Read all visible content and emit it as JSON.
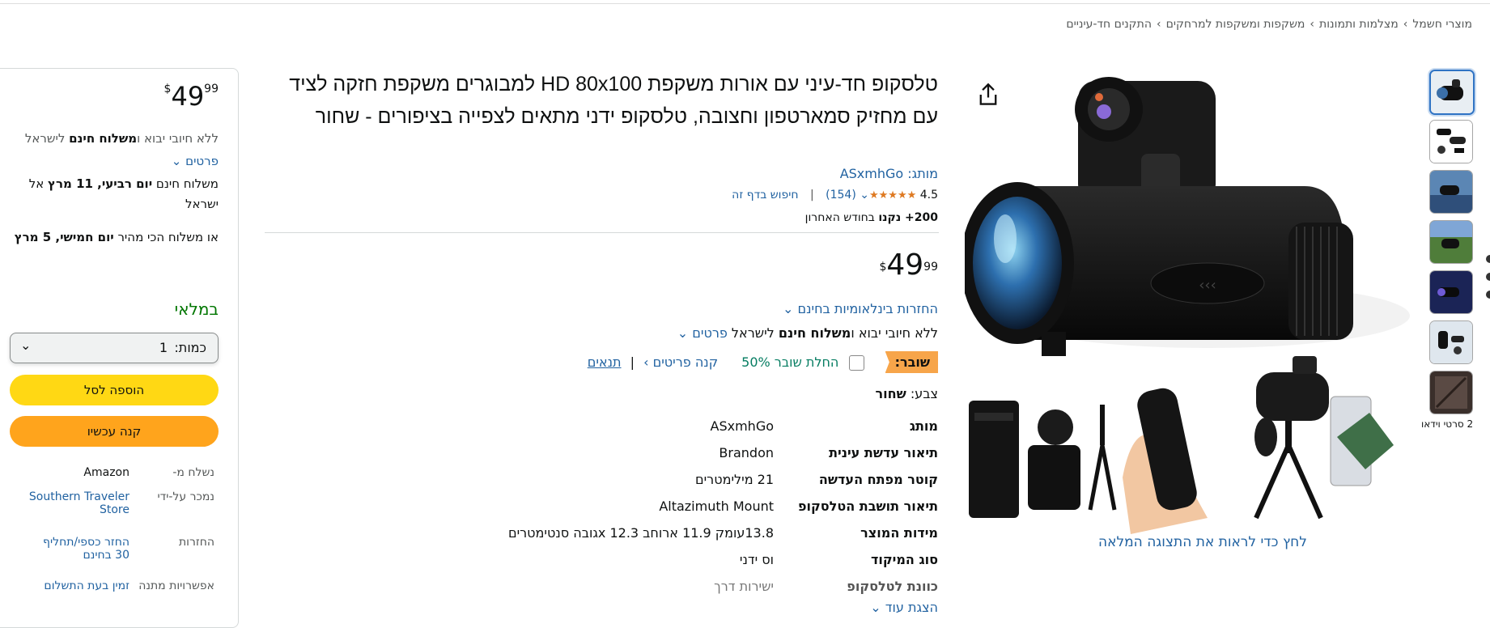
{
  "breadcrumb": [
    "מוצרי חשמל",
    "מצלמות ותמונות",
    "משקפות ומשקפות למרחקים",
    "התקנים חד-עיניים"
  ],
  "gallery": {
    "video_label": "2 סרטי וידאו",
    "full_view_link": "לחץ כדי לראות את התצוגה המלאה"
  },
  "product": {
    "title": "טלסקופ חד-עיני עם אורות משקפת HD 80x100 למבוגרים משקפת חזקה לציד עם מחזיק סמארטפון וחצובה, טלסקופ ידני מתאים לצפייה בציפורים - שחור",
    "brand": "מותג: ASxmhGo",
    "rating": "4.5",
    "stars": "★★★★★",
    "reviews": "(154)",
    "search_page": "חיפוש בדף זה",
    "bought_bold": "200+ נקנו",
    "bought_rest": " בחודש האחרון",
    "price_symbol": "$",
    "price_whole": "49",
    "price_fraction": "99",
    "returns": "החזרות בינלאומיות בחינם",
    "import_a": "ללא חיובי יבוא ו",
    "import_b": "משלוח חינם",
    "import_c": " לישראל ",
    "import_link": "פרטים",
    "coupon_label": "שובר:",
    "coupon_apply": "החלת שובר 50%",
    "coupon_shop": "קנה פריטים ›",
    "coupon_terms": "תנאים",
    "color_label": "צבע:",
    "color_value": "שחור",
    "show_more": "הצגת עוד"
  },
  "specs": [
    {
      "k": "מותג",
      "v": "ASxmhGo"
    },
    {
      "k": "תיאור עדשת עינית",
      "v": "Brandon"
    },
    {
      "k": "קוטר מפתח העדשה",
      "v": "21 מילימטרים"
    },
    {
      "k": "תיאור תושבת הטלסקופ",
      "v": "Altazimuth Mount"
    },
    {
      "k": "מידות המוצר",
      "v": "13.8עומק 11.9 ארוחב 12.3 xגובה סנטימטרים"
    },
    {
      "k": "סוג המיקוד",
      "v": "וס ידני"
    },
    {
      "k": "כוונת לטלסקופ",
      "v": "ישירות דרך"
    }
  ],
  "buybox": {
    "price_symbol": "$",
    "price_whole": "49",
    "price_fraction": "99",
    "import_a": "ללא חיובי יבוא ו",
    "import_b": "משלוח חינם",
    "import_c": " לישראל",
    "details": "פרטים",
    "delivery_a": "משלוח חינם ",
    "delivery_b": "יום רביעי, 11 מרץ",
    "delivery_c": " אל",
    "delivery_d": "ישראל",
    "fast_a": "או משלוח הכי מהיר ",
    "fast_b": "יום חמישי, 5 מרץ",
    "in_stock": "במלאי",
    "qty_label": "כמות:",
    "qty_value": "1",
    "add_to_cart": "הוספה לסל",
    "buy_now": "קנה עכשיו",
    "ships_from_k": "נשלח מ-",
    "ships_from_v": "Amazon",
    "sold_by_k": "נמכר על-ידי",
    "sold_by_v": "Southern Traveler Store",
    "returns_k": "החזרות",
    "returns_v": "החזר כספי/תחליף 30 בחינם",
    "gift_k": "אפשרויות מתנה",
    "gift_v": "זמין בעת התשלום"
  },
  "colors": {
    "cart": "#ffd814",
    "buy": "#ffa41c",
    "link": "#2162a1",
    "instock": "#007600",
    "coupon": "#f7a54a"
  }
}
